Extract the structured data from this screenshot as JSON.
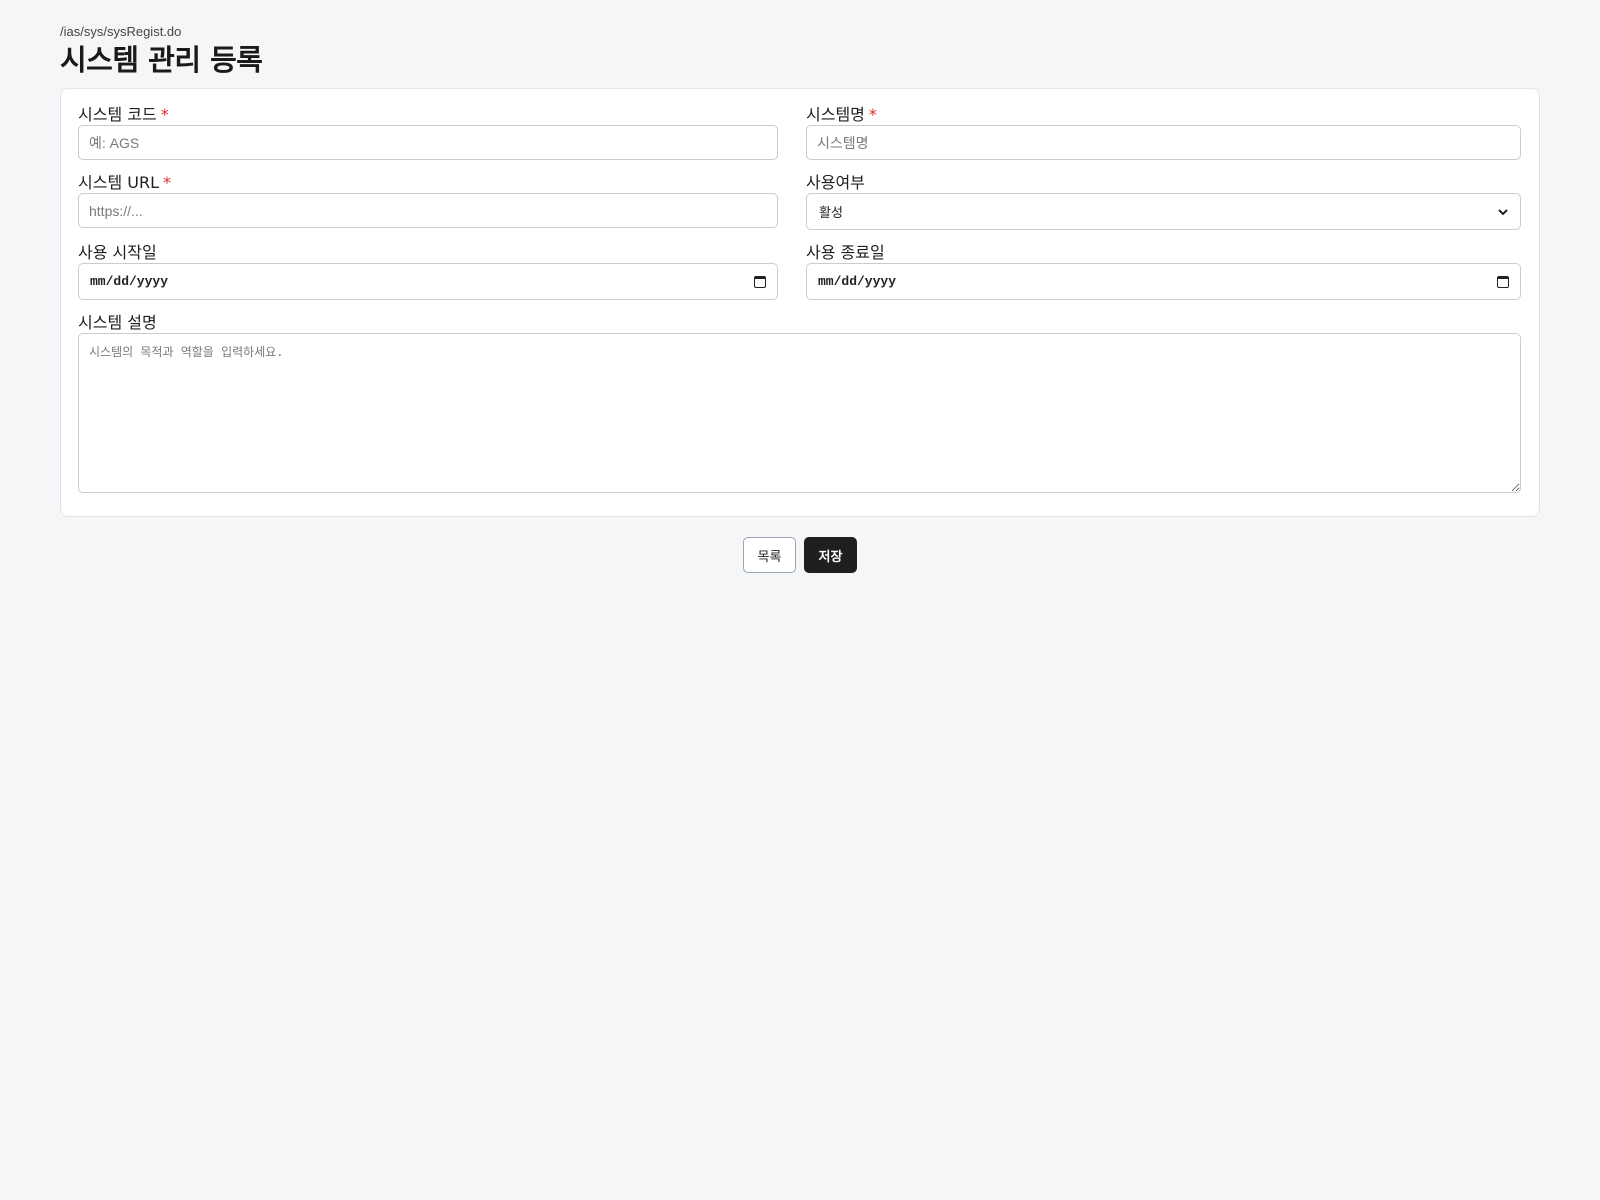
{
  "header": {
    "path": "/ias/sys/sysRegist.do",
    "title": "시스템 관리 등록"
  },
  "form": {
    "required_mark": "*",
    "system_code": {
      "label": "시스템 코드",
      "placeholder": "예: AGS",
      "value": ""
    },
    "system_name": {
      "label": "시스템명",
      "placeholder": "시스템명",
      "value": ""
    },
    "system_url": {
      "label": "시스템 URL",
      "placeholder": "https://...",
      "value": ""
    },
    "use_yn": {
      "label": "사용여부",
      "selected": "활성"
    },
    "start_date": {
      "label": "사용 시작일",
      "placeholder": "mm/dd/yyyy"
    },
    "end_date": {
      "label": "사용 종료일",
      "placeholder": "mm/dd/yyyy"
    },
    "description": {
      "label": "시스템 설명",
      "placeholder": "시스템의 목적과 역할을 입력하세요.",
      "value": ""
    }
  },
  "actions": {
    "list_label": "목록",
    "save_label": "저장"
  },
  "colors": {
    "background": "#f5f6f8",
    "required": "#d32f2f",
    "primary_button": "#1f1f1f"
  },
  "icons": {
    "select": "chevron-down-icon",
    "date": "calendar-icon"
  }
}
